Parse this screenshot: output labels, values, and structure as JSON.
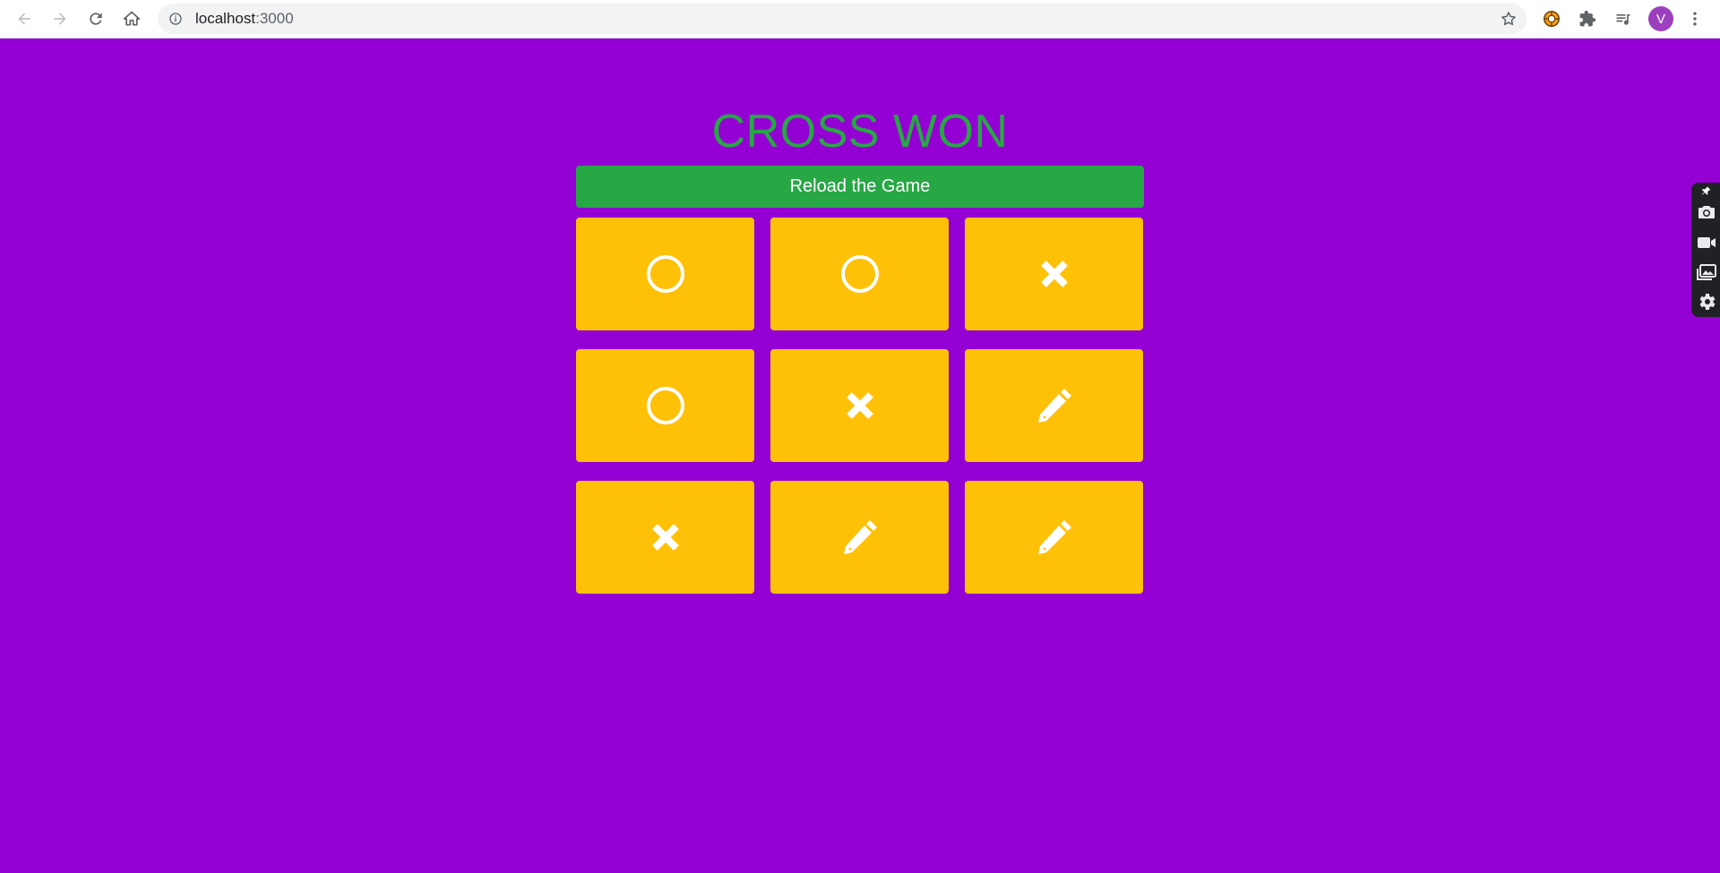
{
  "browser": {
    "url_host": "localhost",
    "url_port": ":3000",
    "profile_initial": "V"
  },
  "game": {
    "status_text": "CROSS WON",
    "reload_label": "Reload the Game",
    "cells": [
      "circle",
      "circle",
      "cross",
      "circle",
      "cross",
      "empty",
      "cross",
      "empty",
      "empty"
    ],
    "colors": {
      "background": "#9400d3",
      "status": "#28a745",
      "button": "#28a745",
      "cell": "#ffc107",
      "mark": "#ffffff"
    }
  },
  "icons": {
    "empty_cell": "pencil-icon",
    "circle_cell": "circle-icon",
    "cross_cell": "cross-icon",
    "side_tools": [
      "camera-icon",
      "video-icon",
      "gallery-icon",
      "settings-icon"
    ]
  }
}
